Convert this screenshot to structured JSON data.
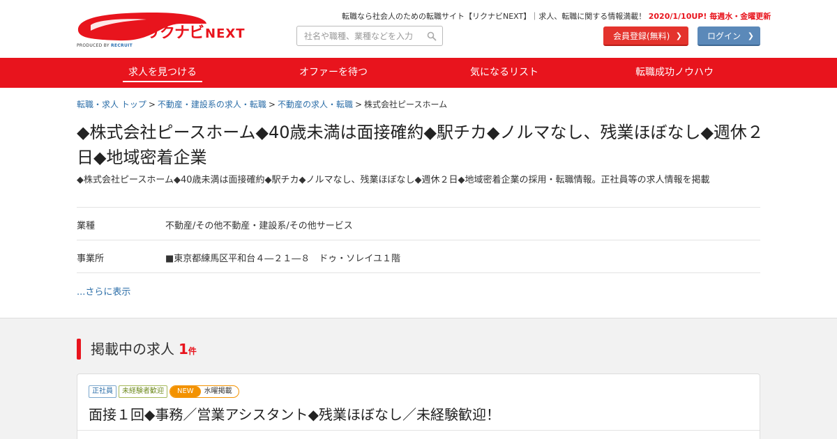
{
  "brand": {
    "name": "リクナビ",
    "suffix": "NEXT",
    "produced_by": "PRODUCED BY",
    "recruit": "RECRUIT"
  },
  "header": {
    "tagline": "転職なら社会人のための転職サイト【リクナビNEXT】｜求人、転職に関する情報満載！",
    "update_note": "2020/1/10UP! 毎週水・金曜更新",
    "search_placeholder": "社名や職種、業種などを入力",
    "register_label": "会員登録(無料)",
    "login_label": "ログイン"
  },
  "nav": {
    "items": [
      {
        "label": "求人を見つける"
      },
      {
        "label": "オファーを待つ"
      },
      {
        "label": "気になるリスト"
      },
      {
        "label": "転職成功ノウハウ"
      }
    ]
  },
  "breadcrumb": {
    "items": [
      {
        "label": "転職・求人 トップ"
      },
      {
        "label": "不動産・建設系の求人・転職"
      },
      {
        "label": "不動産の求人・転職"
      }
    ],
    "current": "株式会社ピースホーム",
    "separator": ">"
  },
  "company": {
    "title": "◆株式会社ピースホーム◆40歳未満は面接確約◆駅チカ◆ノルマなし、残業ほぼなし◆週休２日◆地域密着企業",
    "description": "◆株式会社ピースホーム◆40歳未満は面接確約◆駅チカ◆ノルマなし、残業ほぼなし◆週休２日◆地域密着企業の採用・転職情報。正社員等の求人情報を掲載",
    "info": [
      {
        "key": "業種",
        "value": "不動産/その他不動産・建設系/その他サービス"
      },
      {
        "key": "事業所",
        "value": "■東京都練馬区平和台４―２１―８　ドゥ・ソレイユ１階"
      }
    ],
    "more_label": "...さらに表示"
  },
  "listings": {
    "heading": "掲載中の求人",
    "count": "1",
    "count_unit": "件",
    "jobs": [
      {
        "tag_employment": "正社員",
        "tag_experience": "未経験者歓迎",
        "tag_new": "NEW",
        "tag_day": "水曜掲載",
        "title": "面接１回◆事務／営業アシスタント◆残業ほぼなし／未経験歓迎！"
      }
    ]
  },
  "colors": {
    "brand_red": "#e8141d",
    "link_blue": "#2c6ea8",
    "login_blue": "#5b89b9",
    "new_orange": "#f39200"
  }
}
